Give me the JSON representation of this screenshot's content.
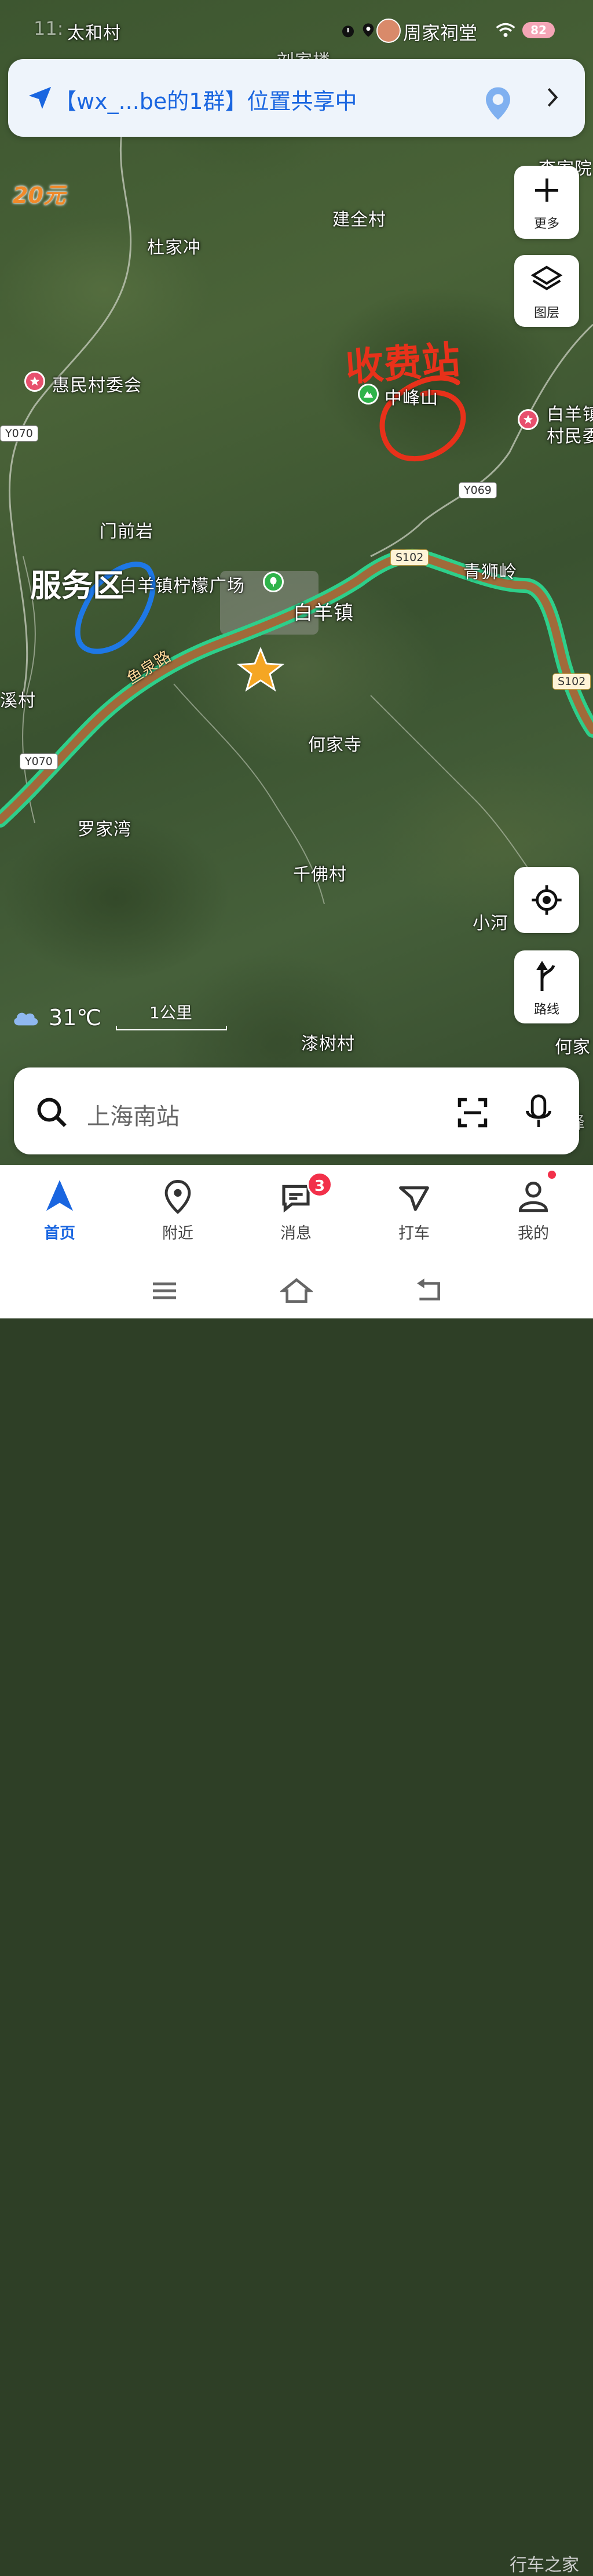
{
  "status_bar": {
    "time": "11:",
    "location_label": "周家祠堂",
    "battery": "82"
  },
  "share_banner": {
    "text": "【wx_...be的1群】位置共享中"
  },
  "price_tag": "20元",
  "map": {
    "places": [
      {
        "name": "太和村"
      },
      {
        "name": "刘家楼"
      },
      {
        "name": "李家院"
      },
      {
        "name": "建全村"
      },
      {
        "name": "杜家冲"
      },
      {
        "name": "惠民村委会"
      },
      {
        "name": "中峰山"
      },
      {
        "name": "白羊镇"
      },
      {
        "name": "村民委"
      },
      {
        "name": "门前岩"
      },
      {
        "name": "白羊镇柠檬广场"
      },
      {
        "name": "白羊镇"
      },
      {
        "name": "青狮岭"
      },
      {
        "name": "溪村"
      },
      {
        "name": "何家寺"
      },
      {
        "name": "罗家湾"
      },
      {
        "name": "千佛村"
      },
      {
        "name": "小河"
      },
      {
        "name": "漆树村"
      },
      {
        "name": "何家"
      },
      {
        "name": "峰"
      }
    ],
    "road_name": "鱼泉路",
    "route_badges": [
      "Y070",
      "Y069",
      "S102",
      "S102",
      "Y070"
    ]
  },
  "annotations": {
    "toll_station": "收费站",
    "service_area": "服务区"
  },
  "side_buttons": {
    "more": "更多",
    "layers": "图层",
    "route": "路线"
  },
  "weather": {
    "temperature": "31℃"
  },
  "scale": {
    "label": "1公里"
  },
  "search": {
    "placeholder": "上海南站"
  },
  "bottom_nav": {
    "items": [
      {
        "label": "首页"
      },
      {
        "label": "附近"
      },
      {
        "label": "消息",
        "badge": "3"
      },
      {
        "label": "打车"
      },
      {
        "label": "我的"
      }
    ]
  },
  "watermark": "行车之家",
  "colors": {
    "accent": "#1a66e0",
    "route_line": "#2ecf8a",
    "toll_annotation": "#e8311a",
    "service_annotation": "#1e78e6",
    "poi_pink": "#e8506e",
    "poi_green": "#2fb34a"
  }
}
